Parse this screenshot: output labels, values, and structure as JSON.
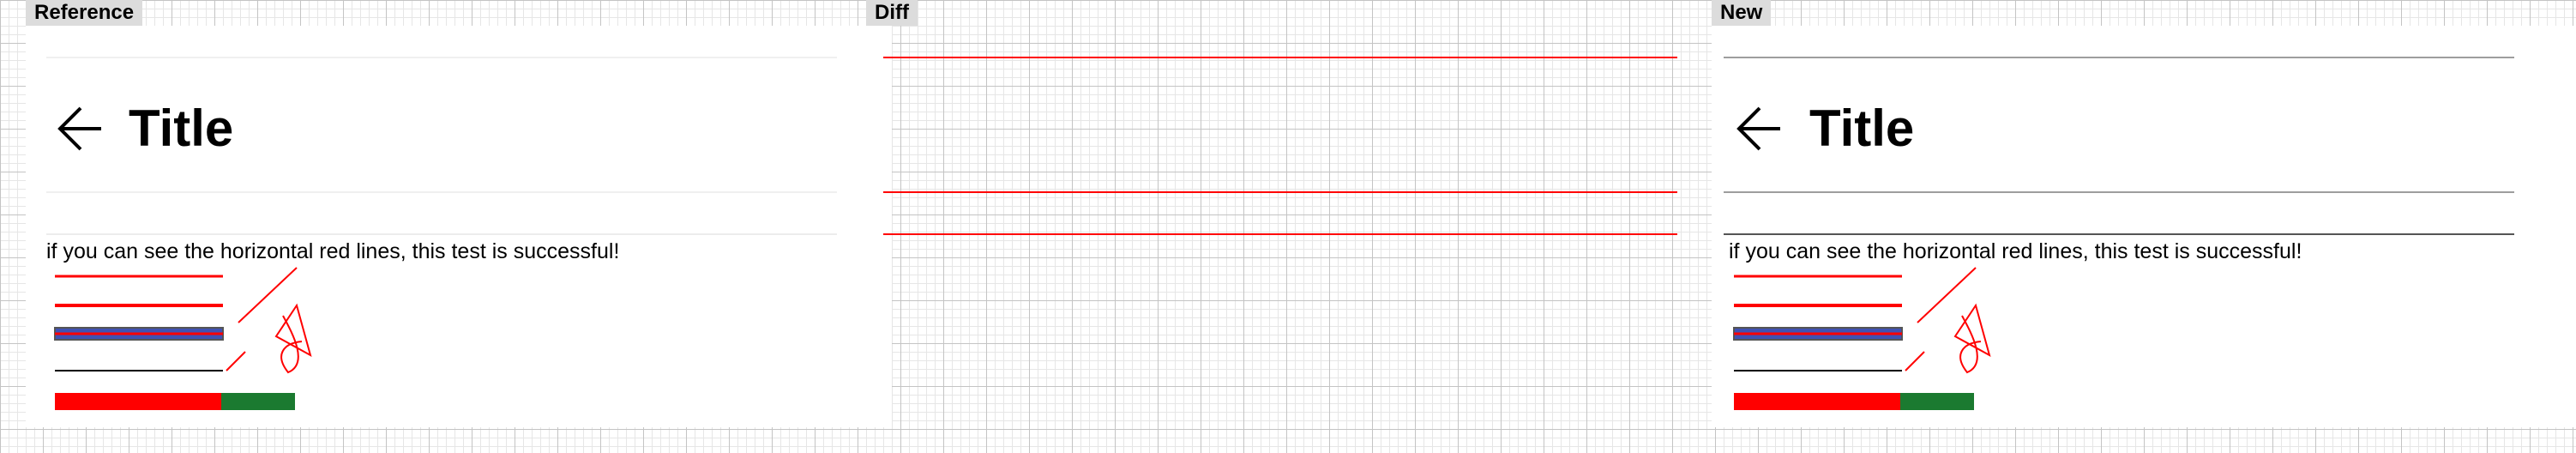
{
  "panels": {
    "reference": {
      "label": "Reference"
    },
    "diff": {
      "label": "Diff"
    },
    "new": {
      "label": "New"
    }
  },
  "toolbar": {
    "title": "Title",
    "back_icon": "arrow-left-icon"
  },
  "message": "if you can see the horizontal red lines, this test is successful!",
  "colors": {
    "line_faint": "#f0f0f0",
    "line_gray": "#9e9e9e",
    "line_dark": "#555555",
    "red": "#ff0000",
    "blue": "#3f51b5",
    "green": "#1b7a30"
  }
}
